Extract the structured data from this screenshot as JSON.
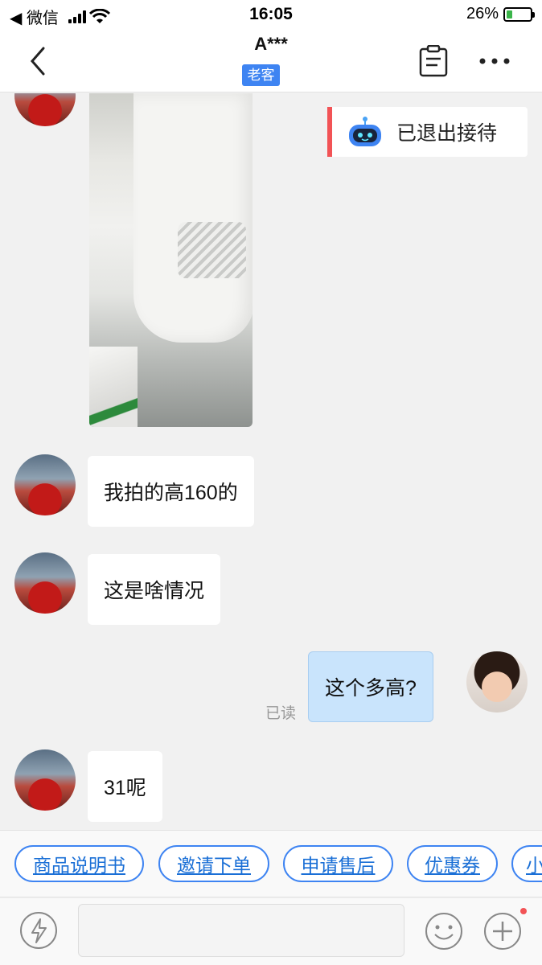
{
  "status_bar": {
    "back_app": "◀ 微信",
    "time": "16:05",
    "battery_pct": "26%",
    "battery_level": 0.26
  },
  "nav": {
    "title": "A***",
    "badge": "老客"
  },
  "system_notice": {
    "text": "已退出接待"
  },
  "messages": [
    {
      "from": "customer",
      "type": "image"
    },
    {
      "from": "customer",
      "type": "text",
      "text": "我拍的高160的"
    },
    {
      "from": "customer",
      "type": "text",
      "text": "这是啥情况"
    },
    {
      "from": "agent",
      "type": "text",
      "text": "这个多高?",
      "status": "已读"
    },
    {
      "from": "customer",
      "type": "text",
      "text": "31呢"
    }
  ],
  "quick_replies": [
    "商品说明书",
    "邀请下单",
    "申请售后",
    "优惠券",
    "小"
  ],
  "colors": {
    "accent": "#3e84f2",
    "self_bubble": "#c9e4fc",
    "notice_bar": "#f25356",
    "background": "#f1f1f1"
  },
  "icons": [
    "back-icon",
    "doc-icon",
    "more-icon",
    "robot-icon",
    "flash-icon",
    "emoji-icon",
    "plus-icon"
  ]
}
